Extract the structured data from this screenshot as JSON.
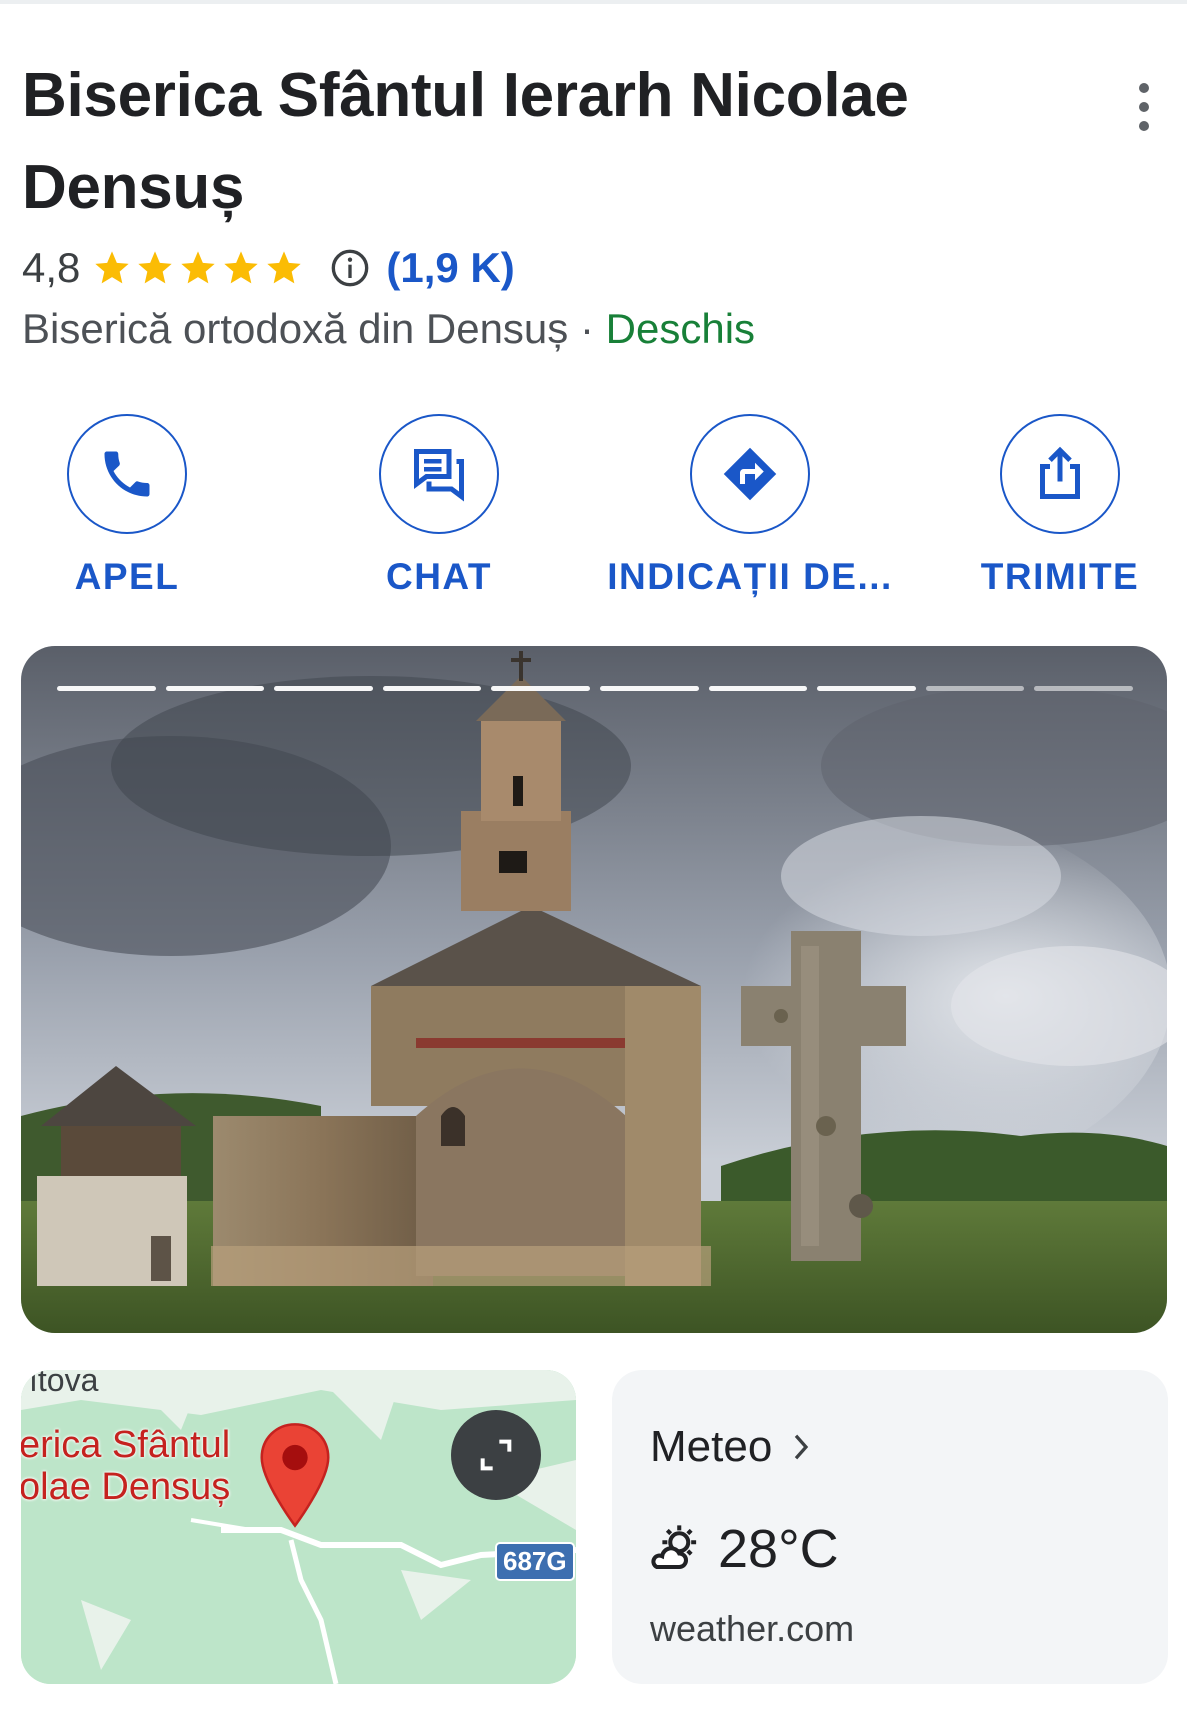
{
  "place": {
    "title": "Biserica Sfântul Ierarh Nicolae Densuș",
    "rating": "4,8",
    "stars": 5,
    "reviews_count": "(1,9 K)",
    "category": "Biserică ortodoxă din Densuș",
    "separator": "·",
    "status": "Deschis"
  },
  "actions": [
    {
      "label": "APEL",
      "icon": "phone-icon"
    },
    {
      "label": "CHAT",
      "icon": "chat-icon"
    },
    {
      "label": "INDICAȚII DE...",
      "icon": "directions-icon"
    },
    {
      "label": "TRIMITE",
      "icon": "share-icon"
    }
  ],
  "photo": {
    "segments_total": 10,
    "segments_viewed": 8
  },
  "map": {
    "top_label": "ıtova",
    "place_label_line1": "erica Sfântul",
    "place_label_line2": "olae Densuș",
    "road": "687G"
  },
  "weather": {
    "title": "Meteo",
    "temperature": "28°C",
    "source": "weather.com",
    "icon": "partly-sunny-icon"
  },
  "colors": {
    "accent": "#1a57c8",
    "open": "#188038",
    "star": "#fbbc04",
    "pin": "#ea4335"
  }
}
